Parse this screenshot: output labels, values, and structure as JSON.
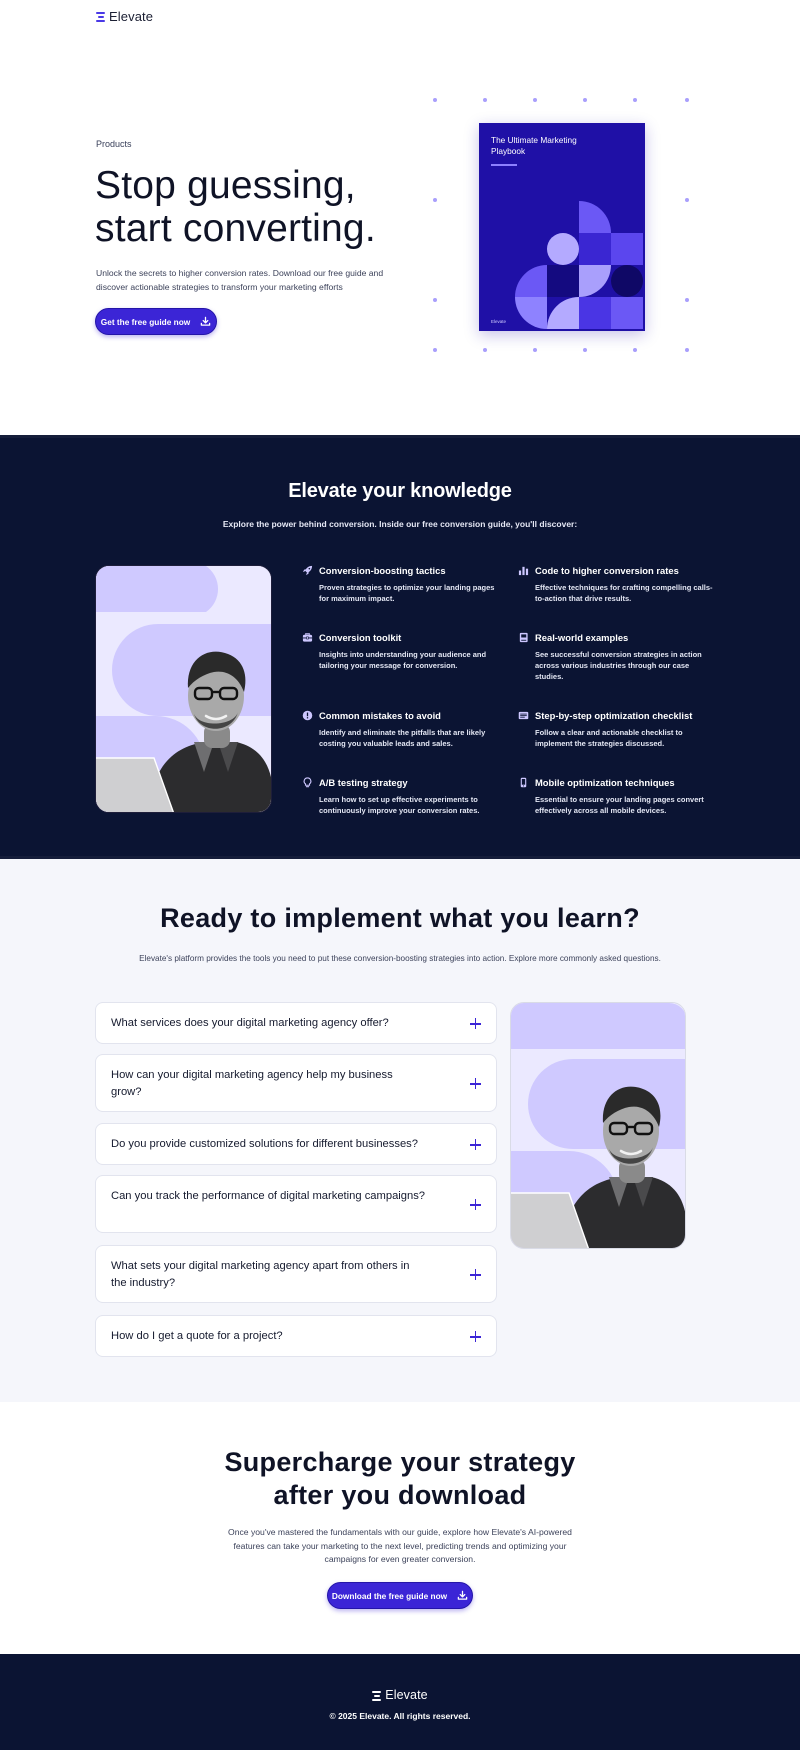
{
  "brand": {
    "name": "Elevate"
  },
  "hero": {
    "eyebrow": "Products",
    "title": "Stop guessing, start converting.",
    "description": "Unlock the secrets to higher conversion rates. Download our free guide and discover actionable strategies to transform your marketing efforts",
    "button_label": "Get the free guide now",
    "book": {
      "title": "The Ultimate Marketing Playbook",
      "brand": "Elevate"
    }
  },
  "knowledge": {
    "title": "Elevate your knowledge",
    "subtitle": "Explore the power behind conversion. Inside our free conversion guide, you'll discover:",
    "features": [
      {
        "icon": "rocket-icon",
        "title": "Conversion-boosting tactics",
        "description": "Proven strategies to optimize your landing pages for maximum impact."
      },
      {
        "icon": "bar-chart-icon",
        "title": "Code to higher conversion rates",
        "description": "Effective techniques for crafting compelling calls-to-action that drive results."
      },
      {
        "icon": "toolbox-icon",
        "title": "Conversion toolkit",
        "description": "Insights into understanding your audience and tailoring your message for conversion."
      },
      {
        "icon": "book-icon",
        "title": "Real-world examples",
        "description": "See successful conversion strategies in action across various industries through our case studies."
      },
      {
        "icon": "alert-icon",
        "title": "Common mistakes to avoid",
        "description": "Identify and eliminate the pitfalls that are likely costing you valuable leads and sales."
      },
      {
        "icon": "checklist-icon",
        "title": "Step-by-step optimization checklist",
        "description": "Follow a clear and actionable checklist to implement the strategies discussed."
      },
      {
        "icon": "lightbulb-icon",
        "title": "A/B testing strategy",
        "description": "Learn how to set up effective experiments to continuously improve your conversion rates."
      },
      {
        "icon": "mobile-icon",
        "title": "Mobile optimization techniques",
        "description": "Essential to ensure your landing pages convert effectively across all mobile devices."
      }
    ]
  },
  "faq": {
    "title": "Ready to implement what you learn?",
    "subtitle": "Elevate's platform provides the tools you need to put these conversion-boosting strategies into action. Explore more commonly asked questions.",
    "items": [
      "What services does your digital marketing agency offer?",
      "How can your digital marketing agency help my business grow?",
      "Do you provide customized solutions for different businesses?",
      "Can you track the performance of digital marketing campaigns?",
      "What sets your digital marketing agency apart from others in the industry?",
      "How do I get a quote for a project?"
    ]
  },
  "cta": {
    "title_line1": "Supercharge your strategy",
    "title_line2": "after you download",
    "description": "Once you've mastered the fundamentals with our guide, explore how Elevate's AI-powered features can take your marketing to the next level, predicting trends and optimizing your campaigns for even greater conversion.",
    "button_label": "Download the free guide now"
  },
  "footer": {
    "copyright": "© 2025 Elevate. All rights reserved."
  },
  "colors": {
    "accent": "#3b25d6",
    "navy": "#0b1433",
    "lavender": "#d3ceff",
    "book": "#1f10a6"
  }
}
